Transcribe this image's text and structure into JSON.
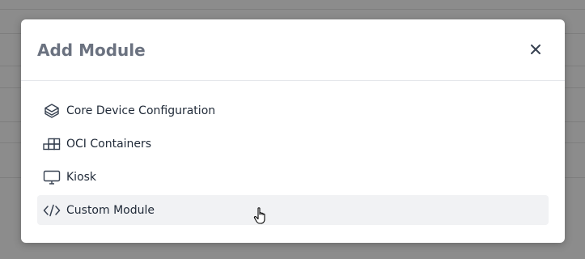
{
  "modal": {
    "title": "Add Module",
    "close_icon": "close-icon"
  },
  "modules": [
    {
      "label": "Core Device Configuration",
      "icon": "layers-icon"
    },
    {
      "label": "OCI Containers",
      "icon": "containers-icon"
    },
    {
      "label": "Kiosk",
      "icon": "monitor-icon"
    },
    {
      "label": "Custom Module",
      "icon": "code-icon"
    }
  ],
  "colors": {
    "title": "#6b7280",
    "item_text": "#1f2937",
    "hover_bg": "#f1f2f4",
    "backdrop": "#8c8c8c"
  }
}
